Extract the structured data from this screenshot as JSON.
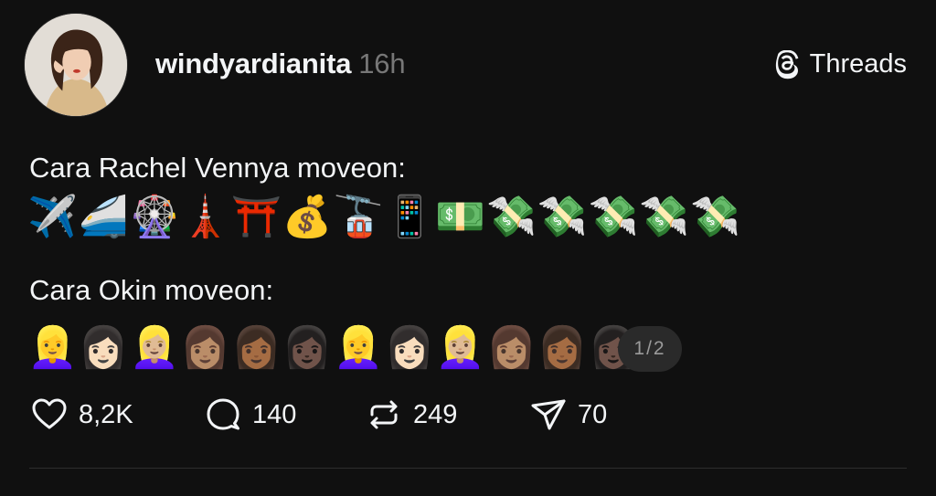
{
  "post": {
    "author": {
      "username": "windyardianita",
      "timestamp": "16h"
    },
    "brand": {
      "label": "Threads",
      "icon": "threads-logo-icon"
    },
    "lines": [
      "Cara Rachel Vennya moveon:",
      "Cara Okin moveon:"
    ],
    "emoji_rows": [
      "✈️🚄🎡🗼⛩️💰🚡📱💵💸💸💸💸💸",
      "👱‍♀️👩🏻👱🏼‍♀️👩🏽👩🏾👩🏿👱‍♀️👩🏻👱🏼‍♀️👩🏽👩🏾👩🏿"
    ],
    "carousel": "1/2",
    "actions": {
      "likes": "8,2K",
      "replies": "140",
      "reposts": "249",
      "shares": "70"
    }
  },
  "colors": {
    "background": "#101010",
    "text": "#f3f5f7",
    "muted": "#777777",
    "badge_bg": "#2a2a2a"
  }
}
